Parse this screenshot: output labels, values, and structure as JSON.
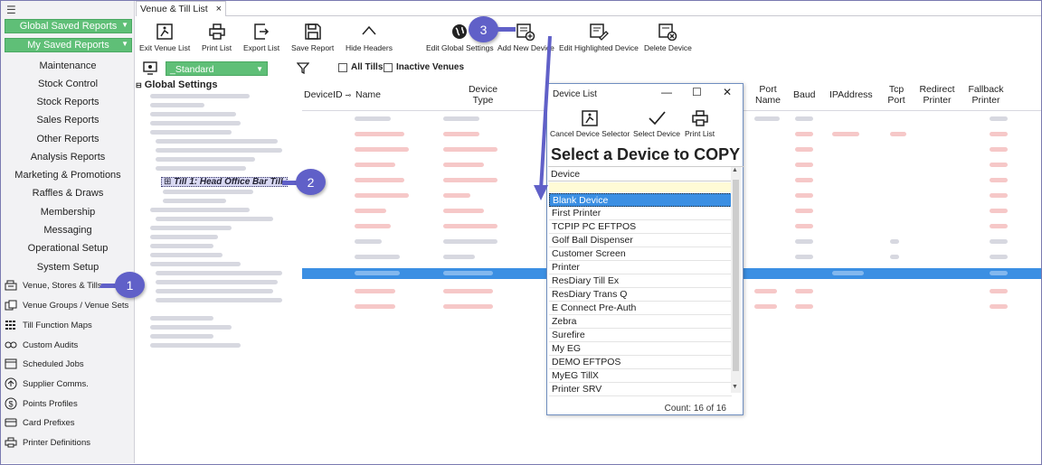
{
  "sidebar": {
    "menu_icon": "hamburger-icon",
    "global_saved_reports": "Global Saved Reports",
    "my_saved_reports": "My Saved Reports",
    "text_items": [
      "Maintenance",
      "Stock Control",
      "Stock Reports",
      "Sales Reports",
      "Other Reports",
      "Analysis Reports",
      "Marketing & Promotions",
      "Raffles & Draws",
      "Membership",
      "Messaging",
      "Operational Setup",
      "System Setup"
    ],
    "icon_items": [
      {
        "label": "Venue, Stores & Tills",
        "icon": "cash-register-icon"
      },
      {
        "label": "Venue Groups / Venue Sets",
        "icon": "venue-groups-icon"
      },
      {
        "label": "Till Function Maps",
        "icon": "grid-keypad-icon"
      },
      {
        "label": "Custom Audits",
        "icon": "audit-icon"
      },
      {
        "label": "Scheduled Jobs",
        "icon": "calendar-icon"
      },
      {
        "label": "Supplier Comms.",
        "icon": "upload-icon"
      },
      {
        "label": "Points Profiles",
        "icon": "dollar-icon"
      },
      {
        "label": "Card Prefixes",
        "icon": "card-icon"
      },
      {
        "label": "Printer Definitions",
        "icon": "printer-icon"
      }
    ]
  },
  "tab": {
    "label": "Venue & Till List",
    "close": "×"
  },
  "toolbar": {
    "exit": "Exit Venue List",
    "print": "Print List",
    "export": "Export List",
    "save": "Save Report",
    "hide": "Hide Headers",
    "edit_global": "Edit Global Settings",
    "add_device": "Add New Device",
    "edit_highlighted": "Edit Highlighted Device",
    "delete_device": "Delete Device"
  },
  "filters": {
    "view_select": "_Standard",
    "all_tills": "All Tills",
    "inactive_venues": "Inactive Venues"
  },
  "tree": {
    "root": "Global Settings",
    "selected": "Till 1: Head Office Bar Till 1"
  },
  "grid": {
    "columns": [
      "DeviceID",
      "Name",
      "Device Type",
      "Port Name",
      "Baud",
      "IPAddress",
      "Tcp Port",
      "Redirect Printer",
      "Fallback Printer"
    ]
  },
  "dialog": {
    "title": "Device List",
    "buttons": {
      "cancel": "Cancel Device Selector",
      "select": "Select Device",
      "print": "Print List"
    },
    "heading": "Select a Device to COPY",
    "column": "Device",
    "items": [
      "Blank Device",
      "First Printer",
      "TCPIP PC EFTPOS",
      "Golf Ball Dispenser",
      "Customer Screen",
      "Printer",
      "ResDiary Till Ex",
      "ResDiary Trans Q",
      "E Connect Pre-Auth",
      "Zebra",
      "Surefire",
      "My EG",
      "DEMO EFTPOS",
      "MyEG TillX",
      "Printer SRV"
    ],
    "selected_index": 0,
    "count": "Count: 16 of 16"
  },
  "callouts": {
    "one": "1",
    "two": "2",
    "three": "3"
  },
  "colors": {
    "green": "#5fbf77",
    "selection_blue": "#3b8fe3",
    "callout": "#6060c8"
  }
}
